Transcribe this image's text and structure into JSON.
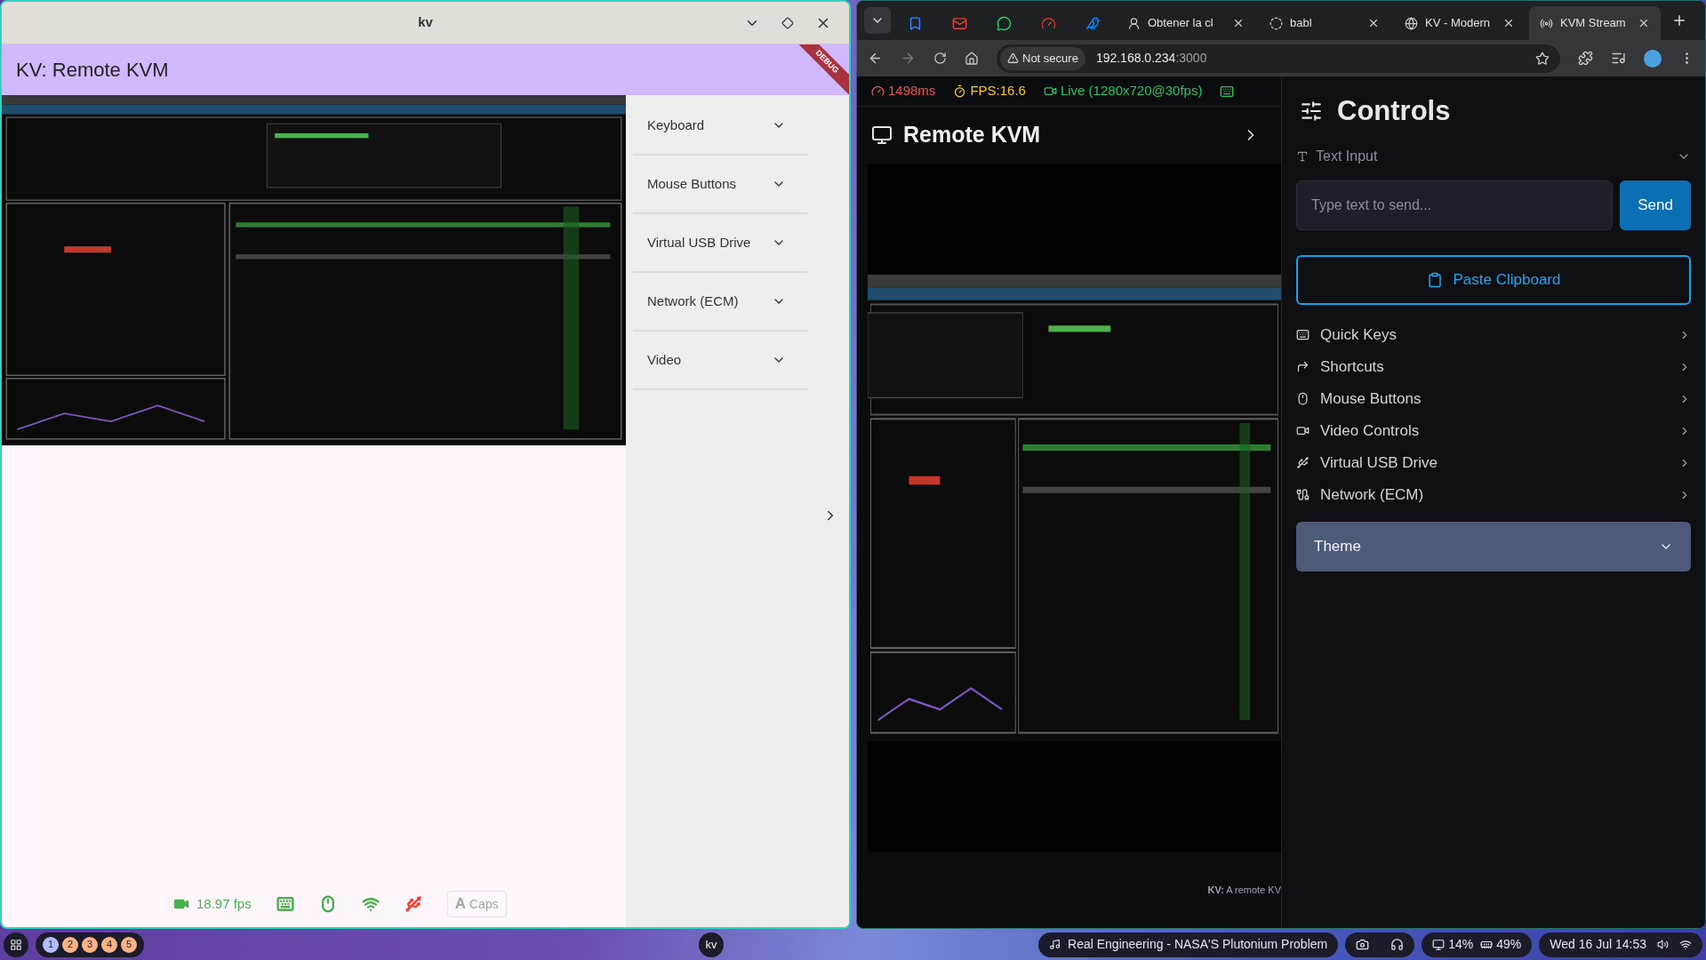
{
  "left_window": {
    "title": "kv",
    "app_title": "KV: Remote KVM",
    "debug_banner": "DEBUG",
    "sidebar": [
      {
        "label": "Keyboard",
        "expanded": false
      },
      {
        "label": "Mouse Buttons",
        "expanded": false
      },
      {
        "label": "Virtual USB Drive",
        "expanded": false
      },
      {
        "label": "Network (ECM)",
        "expanded": false
      },
      {
        "label": "Video",
        "expanded": false
      }
    ],
    "fps": "18.97 fps",
    "indicators": [
      {
        "kind": "keyboard",
        "color": "#4caf50"
      },
      {
        "kind": "mouse",
        "color": "#4caf50"
      },
      {
        "kind": "network",
        "color": "#4caf50"
      },
      {
        "kind": "usb",
        "color": "#f44336"
      }
    ],
    "caps": {
      "glyph": "A",
      "label": "Caps",
      "disabled": true
    }
  },
  "browser": {
    "tabs": [
      {
        "kind": "icon",
        "selected": false
      },
      {
        "kind": "icon",
        "selected": false
      },
      {
        "kind": "icon",
        "selected": false
      },
      {
        "kind": "icon",
        "selected": false
      },
      {
        "kind": "icon",
        "selected": false
      },
      {
        "kind": "text",
        "title": "Obtener la cl",
        "selected": false
      },
      {
        "kind": "text",
        "title": "babl",
        "selected": false
      },
      {
        "kind": "text",
        "title": "KV - Modern",
        "selected": false
      },
      {
        "kind": "text",
        "title": "KVM Stream",
        "selected": true
      }
    ],
    "address": {
      "security": "Not secure",
      "host": "192.168.0.234",
      "port": ":3000"
    },
    "stats": [
      {
        "kind": "latency",
        "text": "1498ms",
        "color": "#f05252"
      },
      {
        "kind": "fps",
        "text": "FPS:16.6",
        "color": "#facc15"
      },
      {
        "kind": "live",
        "text": "Live (1280x720@30fps)",
        "color": "#22c55e"
      }
    ],
    "page_title": "Remote KVM",
    "footer": "**KV:** A remote KV",
    "controls": {
      "title": "Controls",
      "section": "Text Input",
      "placeholder": "Type text to send...",
      "send": "Send",
      "paste": "Paste Clipboard",
      "items": [
        {
          "kind": "keyboard",
          "label": "Quick Keys"
        },
        {
          "kind": "shortcut",
          "label": "Shortcuts"
        },
        {
          "kind": "mouse",
          "label": "Mouse Buttons"
        },
        {
          "kind": "video",
          "label": "Video Controls"
        },
        {
          "kind": "usb",
          "label": "Virtual USB Drive"
        },
        {
          "kind": "network",
          "label": "Network (ECM)"
        }
      ],
      "theme": {
        "label": "Theme",
        "expanded": false
      }
    }
  },
  "taskbar": {
    "workspaces": [
      {
        "label": "1",
        "selected": true
      },
      {
        "label": "2",
        "selected": false
      },
      {
        "label": "3",
        "selected": false
      },
      {
        "label": "4",
        "selected": false
      },
      {
        "label": "5",
        "selected": false
      }
    ],
    "window": "kv",
    "media": "Real Engineering - NASA'S Plutonium Problem",
    "cpu": "14%",
    "memory": "49%",
    "clock": "Wed 16 Jul 14:53"
  }
}
